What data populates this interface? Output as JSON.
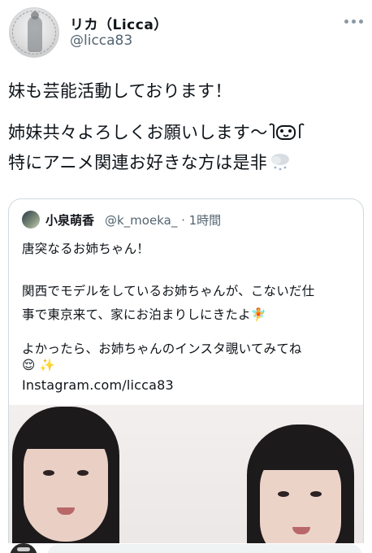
{
  "author": {
    "display_name": "リカ（Licca）",
    "handle": "@licca83"
  },
  "tweet": {
    "line1": "妹も芸能活動しております！",
    "line2": "姉妹共々よろしくお願いします〜",
    "line3": "特にアニメ関連お好きな方は是非",
    "emoji_line2": "ʕ•̫͡•ʔ",
    "emoji_line3": "cloud-snow-emoji"
  },
  "quote": {
    "name": "小泉萌香",
    "handle_time": "@k_moeka_ · 1時間",
    "text_line1": "唐突なるお姉ちゃん！",
    "text_line2": "関西でモデルをしているお姉ちゃんが、こないだ仕",
    "text_line3": "事で東京来て、家にお泊まりしにきたよ🧚",
    "text_line4": "よかったら、お姉ちゃんのインスタ覗いてみてね",
    "emoji_line": "😌 ✨",
    "link": "Instagram.com/licca83"
  },
  "colors": {
    "text_primary": "#0f1419",
    "text_secondary": "#536471",
    "border": "#cfd9de",
    "link": "#0f1419"
  },
  "icons": [
    "more-horizontal-icon",
    "avatar-image",
    "quote-avatar-image"
  ]
}
